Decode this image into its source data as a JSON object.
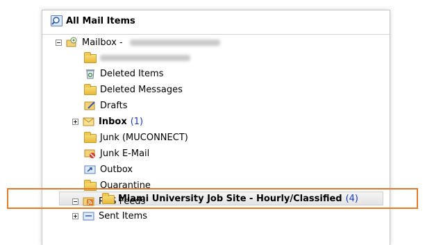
{
  "pane": {
    "title": "All Mail Items"
  },
  "tree": {
    "mailbox": {
      "label": "Mailbox -"
    },
    "folders": [
      {
        "label": "Deleted Items"
      },
      {
        "label": "Deleted Messages"
      },
      {
        "label": "Drafts"
      },
      {
        "label": "Inbox",
        "count": "(1)"
      },
      {
        "label": "Junk (MUCONNECT)"
      },
      {
        "label": "Junk E-Mail"
      },
      {
        "label": "Outbox"
      },
      {
        "label": "Quarantine"
      },
      {
        "label": "RSS Feeds"
      },
      {
        "label": "Miami University Job Site - Hourly/Classified",
        "count": "(4)"
      },
      {
        "label": "Sent Items"
      }
    ]
  },
  "colors": {
    "highlight": "#e07c2c",
    "count": "#1a38c8"
  }
}
